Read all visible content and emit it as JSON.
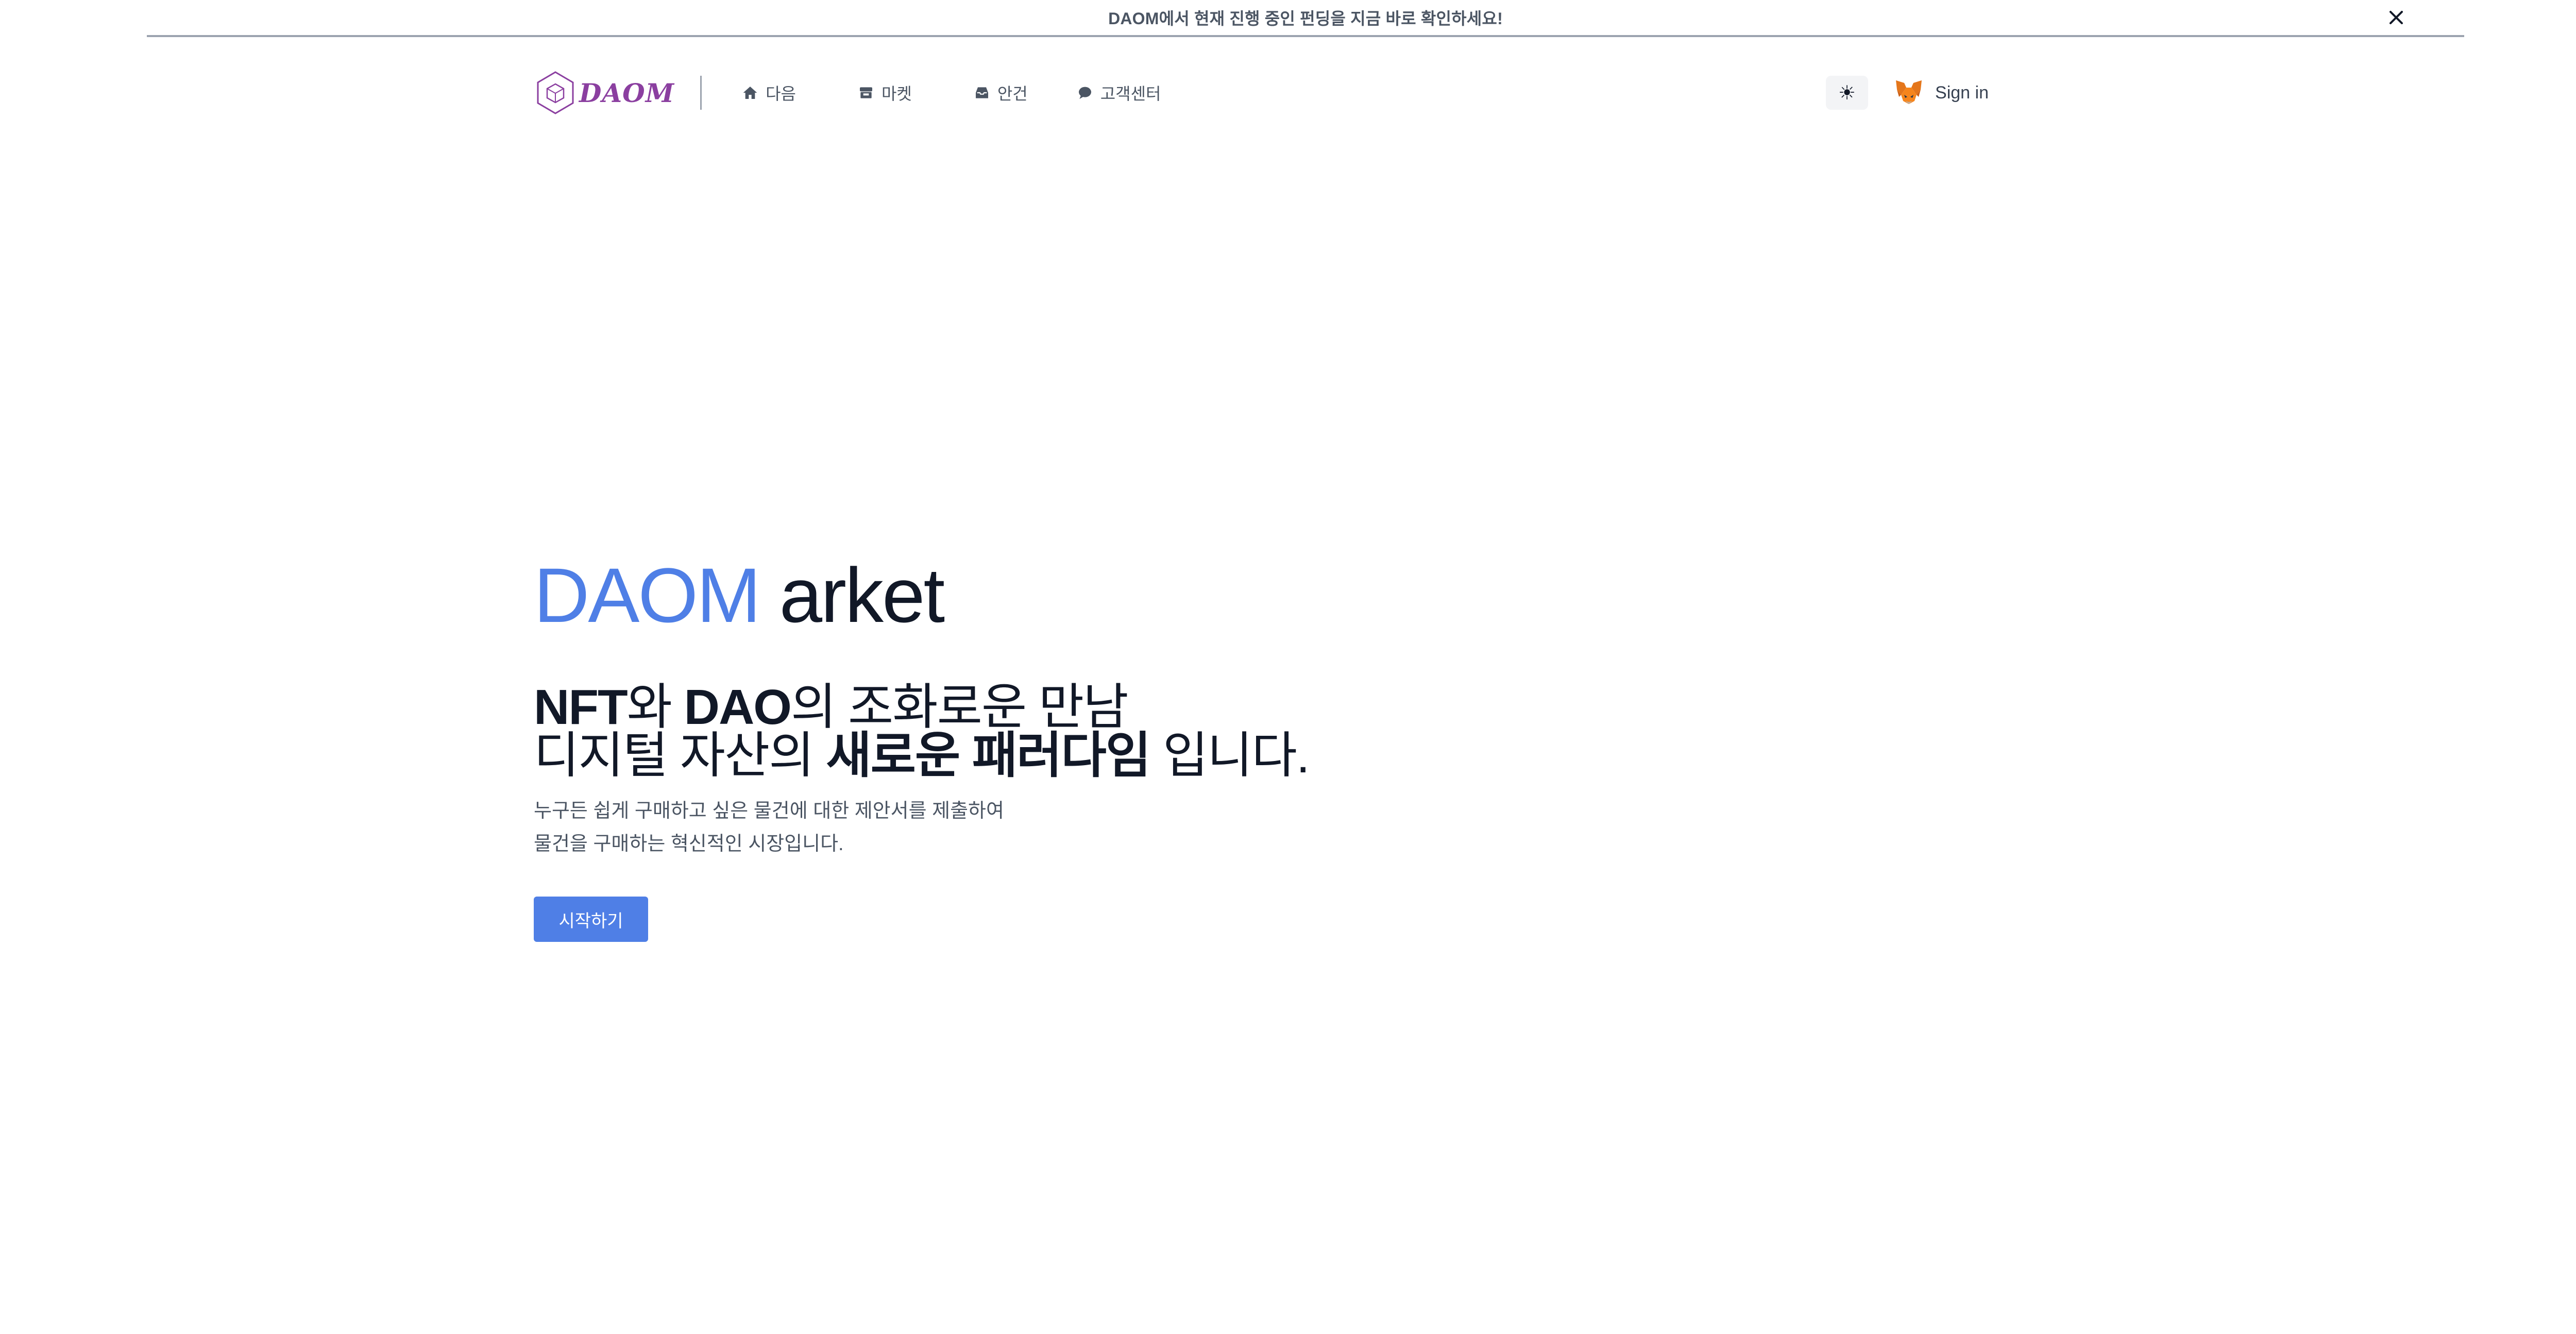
{
  "banner": {
    "text": "DAOM에서 현재 진행 중인 펀딩을 지금 바로 확인하세요!",
    "close_icon": "close-icon"
  },
  "header": {
    "logo_text": "DAOM",
    "nav": [
      {
        "label": "다음",
        "icon": "home-icon"
      },
      {
        "label": "마켓",
        "icon": "store-icon"
      },
      {
        "label": "안건",
        "icon": "inbox-icon"
      },
      {
        "label": "고객센터",
        "icon": "chat-icon"
      }
    ],
    "theme_toggle_glyph": "☀",
    "signin_label": "Sign in",
    "signin_icon": "metamask-fox-icon"
  },
  "hero": {
    "title_accent": "DAOM",
    "title_rest": " arket",
    "line1": {
      "p1": "NFT",
      "p2": "와 ",
      "p3": "DAO",
      "p4": "의 조화로운 만남"
    },
    "line2": {
      "p1": "디지털 자산의 ",
      "p2": "새로운 패러다임",
      "p3": " 입니다."
    },
    "desc_line1": "누구든 쉽게 구매하고 싶은 물건에 대한 제안서를 제출하여",
    "desc_line2": "물건을 구매하는 혁신적인 시장입니다.",
    "cta_label": "시작하기"
  },
  "colors": {
    "accent": "#4f7fe6",
    "logo": "#8b3fa0",
    "text_muted": "#4b5563"
  }
}
